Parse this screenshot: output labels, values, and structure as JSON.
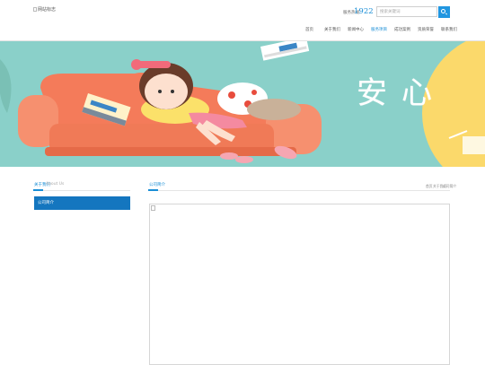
{
  "header": {
    "logo_alt": "网站标志",
    "hotline_label": "服务热线：",
    "hotline_number": "1922",
    "search_placeholder": "搜索关键词"
  },
  "nav": {
    "items": [
      {
        "label": "首页",
        "active": false
      },
      {
        "label": "关于我们",
        "active": false
      },
      {
        "label": "新闻中心",
        "active": false
      },
      {
        "label": "服务项目",
        "active": true
      },
      {
        "label": "成功案例",
        "active": false
      },
      {
        "label": "资质荣誉",
        "active": false
      },
      {
        "label": "联系我们",
        "active": false
      }
    ]
  },
  "banner": {
    "slogan": "安心"
  },
  "sidebar": {
    "title": "关于我们",
    "subtitle": "About Us",
    "items": [
      {
        "label": "公司简介"
      }
    ]
  },
  "main": {
    "title": "公司简介",
    "breadcrumb": [
      "首页",
      "关于我们",
      "公司简介"
    ]
  },
  "colors": {
    "accent": "#1a8ed6",
    "sidebar_active": "#1476bf",
    "banner_bg": "#8ad0c9",
    "sofa": "#f47b5a"
  }
}
